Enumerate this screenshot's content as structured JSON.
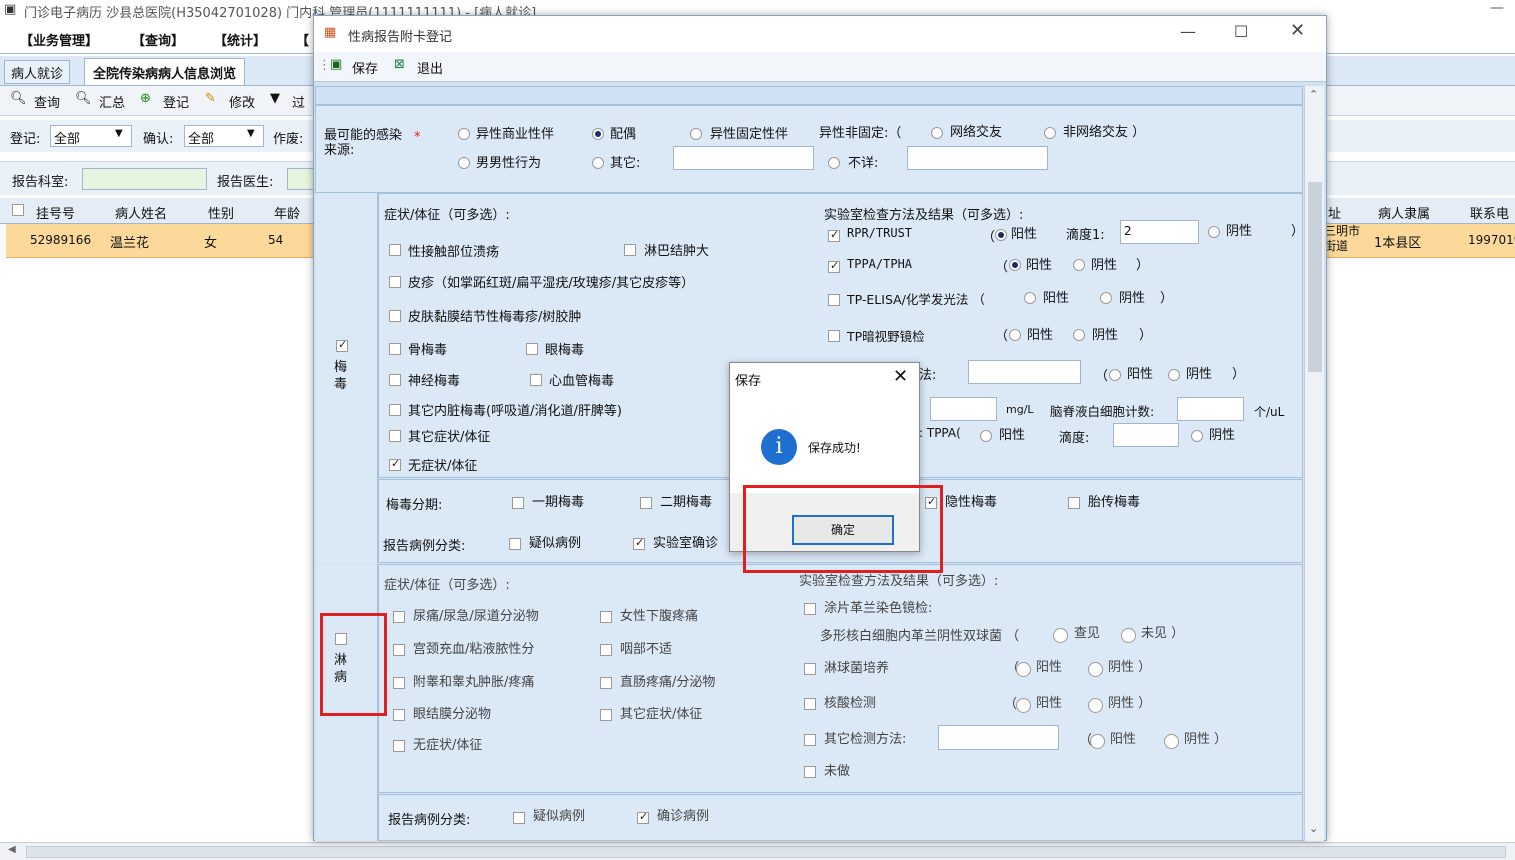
{
  "main": {
    "title": "门诊电子病历  沙县总医院(H35042701028)  门内科  管理员(1111111111) - [病人就诊]",
    "menu": [
      "【业务管理】",
      "【查询】",
      "【统计】",
      "【"
    ],
    "tabs": [
      "病人就诊",
      "全院传染病病人信息浏览"
    ],
    "toolbar": [
      "查询",
      "汇总",
      "登记",
      "修改",
      "过"
    ],
    "filter": {
      "reg_label": "登记:",
      "reg_value": "全部",
      "confirm_label": "确认:",
      "confirm_value": "全部",
      "void_label": "作废:",
      "dept_label": "报告科室:",
      "doctor_label": "报告医生:"
    },
    "columns": [
      "挂号号",
      "病人姓名",
      "性别",
      "年龄",
      "址",
      "病人隶属",
      "联系电"
    ],
    "row": {
      "reg_no": "52989166",
      "name": "温兰花",
      "sex": "女",
      "age": "54",
      "addr": "三明市\n街道",
      "belong": "1本县区",
      "phone": "1997019"
    }
  },
  "dialog": {
    "title": "性病报告附卡登记",
    "save": "保存",
    "exit": "退出",
    "source": {
      "label": "最可能的感染\n来源:",
      "star": "*",
      "o1": "异性商业性伴",
      "o2": "配偶",
      "o3": "异性固定性伴",
      "o4": "异性非固定:（",
      "o5": "网络交友",
      "o6": "非网络交友 ）",
      "o7": "男男性行为",
      "o8": "其它:",
      "o9": "不详:"
    },
    "syphilis": {
      "side": "梅\n毒",
      "sym_title": "症状/体征（可多选）:",
      "s1": "性接触部位溃疡",
      "s2": "淋巴结肿大",
      "s3": "皮疹（如掌跖红斑/扁平湿疣/玫瑰疹/其它皮疹等）",
      "s4": "皮肤黏膜结节性梅毒疹/树胶肿",
      "s5": "骨梅毒",
      "s6": "眼梅毒",
      "s7": "神经梅毒",
      "s8": "心血管梅毒",
      "s9": "其它内脏梅毒(呼吸道/消化道/肝脾等)",
      "s10": "其它症状/体征",
      "s11": "无症状/体征",
      "lab_title": "实验室检查方法及结果（可多选）:",
      "l1": "RPR/TRUST",
      "l1b": "（",
      "pos": "阳性",
      "l1c": "滴度1:",
      "l1val": "2",
      "neg": "阴性",
      "paren": "）",
      "l2": "TPPA/TPHA",
      "l3": "TP-ELISA/化学发光法 （",
      "l4": "TP暗视野镜检",
      "l5": "法:",
      "l6unit": "mg/L",
      "l6b": "脑脊液白细胞计数:",
      "l6unit2": "个/uL",
      "l7": ": TPPA(",
      "l7b": "滴度:",
      "stage_label": "梅毒分期:",
      "st1": "一期梅毒",
      "st2": "二期梅毒",
      "st3": "隐性梅毒",
      "st4": "胎传梅毒",
      "cls_label": "报告病例分类:",
      "c1": "疑似病例",
      "c2": "实验室确诊"
    },
    "gonorrhea": {
      "side": "淋\n病",
      "sym_title": "症状/体征（可多选）:",
      "g1": "尿痛/尿急/尿道分泌物",
      "g2": "女性下腹疼痛",
      "g3": "宫颈充血/粘液脓性分",
      "g4": "咽部不适",
      "g5": "附睾和睾丸肿胀/疼痛",
      "g6": "直肠疼痛/分泌物",
      "g7": "眼结膜分泌物",
      "g8": "其它症状/体征",
      "g9": "无症状/体征",
      "lab_title": "实验室检查方法及结果（可多选）:",
      "k1": "涂片革兰染色镜检:",
      "k1b": "多形核白细胞内革兰阴性双球菌 （",
      "seen": "查见",
      "unseen": "未见 ）",
      "k2": "淋球菌培养",
      "k3": "核酸检测",
      "k4": "其它检测方法:",
      "k5": "未做",
      "lp": "（",
      "pos": "阳性",
      "neg": "阴性 ）",
      "cls_label": "报告病例分类:",
      "c1": "疑似病例",
      "c2": "确诊病例"
    }
  },
  "msgbox": {
    "title": "保存",
    "text": "保存成功!",
    "ok": "确定"
  },
  "colors": {
    "form_bg": "#cfe1f3",
    "highlight": "#fcd99a",
    "annotation": "#e02020"
  }
}
